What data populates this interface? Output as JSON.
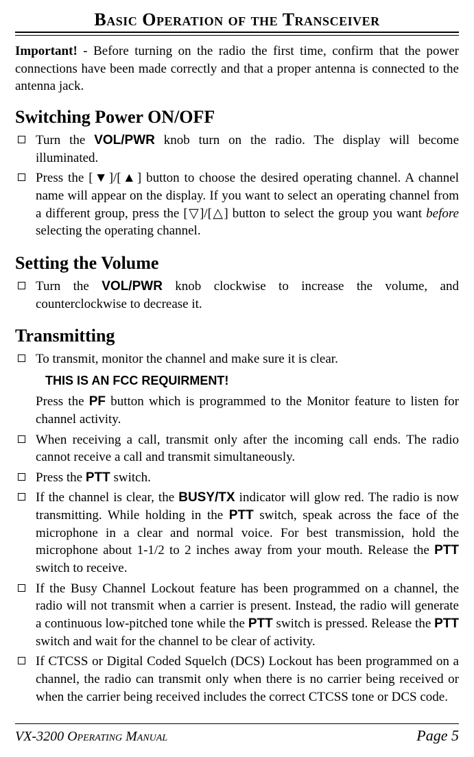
{
  "banner": "Basic Operation of the Transceiver",
  "intro": {
    "lead": "Important!",
    "rest": " - Before turning on the radio the first time, confirm that the power connections have been made correctly and that a proper antenna is connected to the antenna jack."
  },
  "sections": {
    "power": {
      "title": "Switching Power ON/OFF",
      "items": [
        {
          "pre": "Turn the ",
          "b1": "VOL/PWR",
          "post": " knob turn on the radio. The display will become illuminated."
        },
        {
          "pre": "Press the [",
          "s1": "▼",
          "mid1": "]/[",
          "s2": "▲",
          "mid2": "] button to choose the desired operating channel. A channel name will appear on the display. If you want to select an operating channel from a different group, press the [",
          "s3": "▽",
          "mid3": "]/[",
          "s4": "△",
          "mid4": "] button to select the group you want ",
          "it": "before",
          "post": " selecting the operating channel."
        }
      ]
    },
    "volume": {
      "title": "Setting the Volume",
      "items": [
        {
          "pre": "Turn the ",
          "b1": "VOL/PWR",
          "post": " knob clockwise to increase the volume, and counterclockwise to decrease it."
        }
      ]
    },
    "tx": {
      "title": "Transmitting",
      "items": [
        {
          "line": "To transmit, monitor the channel and make sure it is clear.",
          "fcc": "THIS IS AN FCC REQUIRMENT!",
          "sub_pre": "Press the ",
          "sub_b": "PF",
          "sub_post": " button which is programmed to the Monitor feature to listen for channel activity."
        },
        {
          "text": "When receiving a call, transmit only after the incoming call ends. The radio cannot receive a call and transmit simultaneously."
        },
        {
          "pre": "Press the ",
          "b1": "PTT",
          "post": " switch."
        },
        {
          "pre": "If the channel is clear, the ",
          "b1": "BUSY/TX",
          "mid1": " indicator will glow red. The radio is now transmitting. While holding in the ",
          "b2": "PTT",
          "mid2": " switch, speak across the face of the microphone in a clear and normal voice. For best transmission, hold the microphone about 1-1/2 to 2 inches away from your mouth. Release the ",
          "b3": "PTT",
          "post": " switch to receive."
        },
        {
          "pre": "If the Busy Channel Lockout feature has been programmed on a channel, the radio will not transmit when a carrier is present. Instead, the radio will generate a continuous low-pitched tone while the ",
          "b1": "PTT",
          "mid1": " switch is pressed. Release the ",
          "b2": "PTT",
          "post": " switch and wait for the channel to be clear of activity."
        },
        {
          "text": "If CTCSS or Digital Coded Squelch (DCS) Lockout has been programmed on a channel, the radio can transmit only when there is no carrier being received or when the carrier being received includes the correct CTCSS tone or DCS code."
        }
      ]
    }
  },
  "footer": {
    "left": "VX-3200 Operating Manual",
    "right": "Page 5"
  }
}
